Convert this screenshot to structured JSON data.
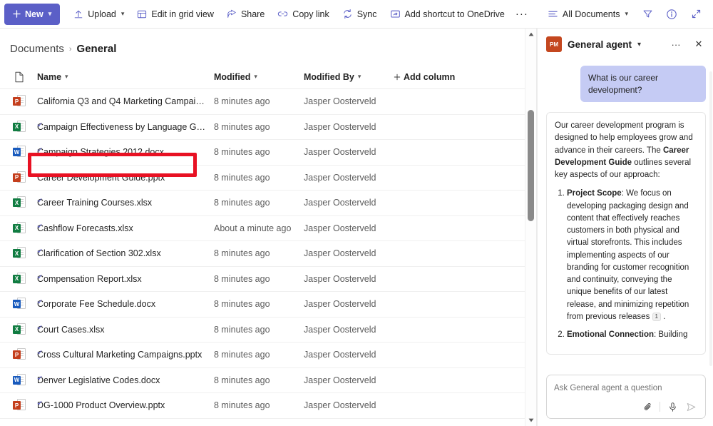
{
  "toolbar": {
    "new_label": "New",
    "upload_label": "Upload",
    "edit_grid_label": "Edit in grid view",
    "share_label": "Share",
    "copy_link_label": "Copy link",
    "sync_label": "Sync",
    "add_shortcut_label": "Add shortcut to OneDrive",
    "overflow_label": "···",
    "view_label": "All Documents",
    "filter_icon": "filter-icon",
    "info_icon": "info-icon",
    "expand_icon": "expand-icon"
  },
  "breadcrumb": {
    "root": "Documents",
    "separator": "›",
    "current": "General"
  },
  "columns": {
    "name": "Name",
    "modified": "Modified",
    "modified_by": "Modified By",
    "add_column": "Add column"
  },
  "files": [
    {
      "name": "California Q3 and Q4 Marketing Campaign....",
      "type": "pptx",
      "badge": "P",
      "modified": "8 minutes ago",
      "modified_by": "Jasper Oosterveld",
      "sparkle": false,
      "highlighted": false
    },
    {
      "name": "Campaign Effectiveness by Language Grou...",
      "type": "xlsx",
      "badge": "X",
      "modified": "8 minutes ago",
      "modified_by": "Jasper Oosterveld",
      "sparkle": true,
      "highlighted": false
    },
    {
      "name": "Campaign Strategies 2012.docx",
      "type": "docx",
      "badge": "W",
      "modified": "8 minutes ago",
      "modified_by": "Jasper Oosterveld",
      "sparkle": true,
      "highlighted": false
    },
    {
      "name": "Career Development Guide.pptx",
      "type": "pptx",
      "badge": "P",
      "modified": "8 minutes ago",
      "modified_by": "Jasper Oosterveld",
      "sparkle": true,
      "highlighted": true
    },
    {
      "name": "Career Training Courses.xlsx",
      "type": "xlsx",
      "badge": "X",
      "modified": "8 minutes ago",
      "modified_by": "Jasper Oosterveld",
      "sparkle": true,
      "highlighted": false
    },
    {
      "name": "Cashflow Forecasts.xlsx",
      "type": "xlsx",
      "badge": "X",
      "modified": "About a minute ago",
      "modified_by": "Jasper Oosterveld",
      "sparkle": true,
      "highlighted": false
    },
    {
      "name": "Clarification of Section 302.xlsx",
      "type": "xlsx",
      "badge": "X",
      "modified": "8 minutes ago",
      "modified_by": "Jasper Oosterveld",
      "sparkle": true,
      "highlighted": false
    },
    {
      "name": "Compensation Report.xlsx",
      "type": "xlsx",
      "badge": "X",
      "modified": "8 minutes ago",
      "modified_by": "Jasper Oosterveld",
      "sparkle": true,
      "highlighted": false
    },
    {
      "name": "Corporate Fee Schedule.docx",
      "type": "docx",
      "badge": "W",
      "modified": "8 minutes ago",
      "modified_by": "Jasper Oosterveld",
      "sparkle": true,
      "highlighted": false
    },
    {
      "name": "Court Cases.xlsx",
      "type": "xlsx",
      "badge": "X",
      "modified": "8 minutes ago",
      "modified_by": "Jasper Oosterveld",
      "sparkle": true,
      "highlighted": false
    },
    {
      "name": "Cross Cultural Marketing Campaigns.pptx",
      "type": "pptx",
      "badge": "P",
      "modified": "8 minutes ago",
      "modified_by": "Jasper Oosterveld",
      "sparkle": true,
      "highlighted": false
    },
    {
      "name": "Denver Legislative Codes.docx",
      "type": "docx",
      "badge": "W",
      "modified": "8 minutes ago",
      "modified_by": "Jasper Oosterveld",
      "sparkle": true,
      "highlighted": false
    },
    {
      "name": "DG-1000 Product Overview.pptx",
      "type": "pptx",
      "badge": "P",
      "modified": "8 minutes ago",
      "modified_by": "Jasper Oosterveld",
      "sparkle": true,
      "highlighted": false
    }
  ],
  "agent": {
    "avatar_initials": "PM",
    "title": "General agent",
    "more_label": "···",
    "close_label": "✕",
    "user_message": "What is our career development?",
    "reply_intro_a": "Our career development program is designed to help employees grow and advance in their careers. The ",
    "reply_intro_bold": "Career Development Guide",
    "reply_intro_b": " outlines several key aspects of our approach:",
    "item1_bold": "Project Scope",
    "item1_text": ": We focus on developing packaging design and content that effectively reaches customers in both physical and virtual storefronts. This includes implementing aspects of our branding for customer recognition and continuity, conveying the unique benefits of our latest release, and minimizing repetition from previous releases ",
    "item1_citation": "1",
    "item1_tail": " .",
    "item2_bold": "Emotional Connection",
    "item2_text": ": Building",
    "composer_placeholder": "Ask General agent a question",
    "attach_icon": "paperclip-icon",
    "mic_icon": "microphone-icon",
    "send_icon": "send-icon"
  },
  "colors": {
    "accent": "#5b5fc7",
    "highlight": "#e81123",
    "user_bubble": "#c5cbf4",
    "avatar": "#c4471f"
  }
}
